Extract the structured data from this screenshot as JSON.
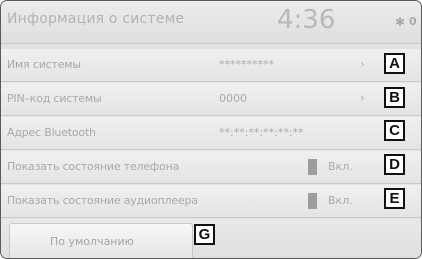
{
  "header": {
    "title": "Информация о системе",
    "clock": "4:36",
    "bluetooth_icon": "bluetooth-icon"
  },
  "rows": [
    {
      "label": "Имя системы",
      "value": "**********",
      "arrow": "›",
      "callout": "A"
    },
    {
      "label": "PIN–код системы",
      "value": "0000",
      "arrow": "›",
      "callout": "B"
    },
    {
      "label": "Адрес Bluetooth",
      "value": "**:**:**:**:**:**",
      "callout": "C"
    },
    {
      "label": "Показать состояние телефона",
      "toggle": "Вкл.",
      "toggle_on": true,
      "callout": "D"
    },
    {
      "label": "Показать состояние аудиоплеера",
      "toggle": "Вкл.",
      "toggle_on": true,
      "callout": "E"
    }
  ],
  "footer": {
    "default_label": "По умолчанию",
    "callout": "G"
  }
}
